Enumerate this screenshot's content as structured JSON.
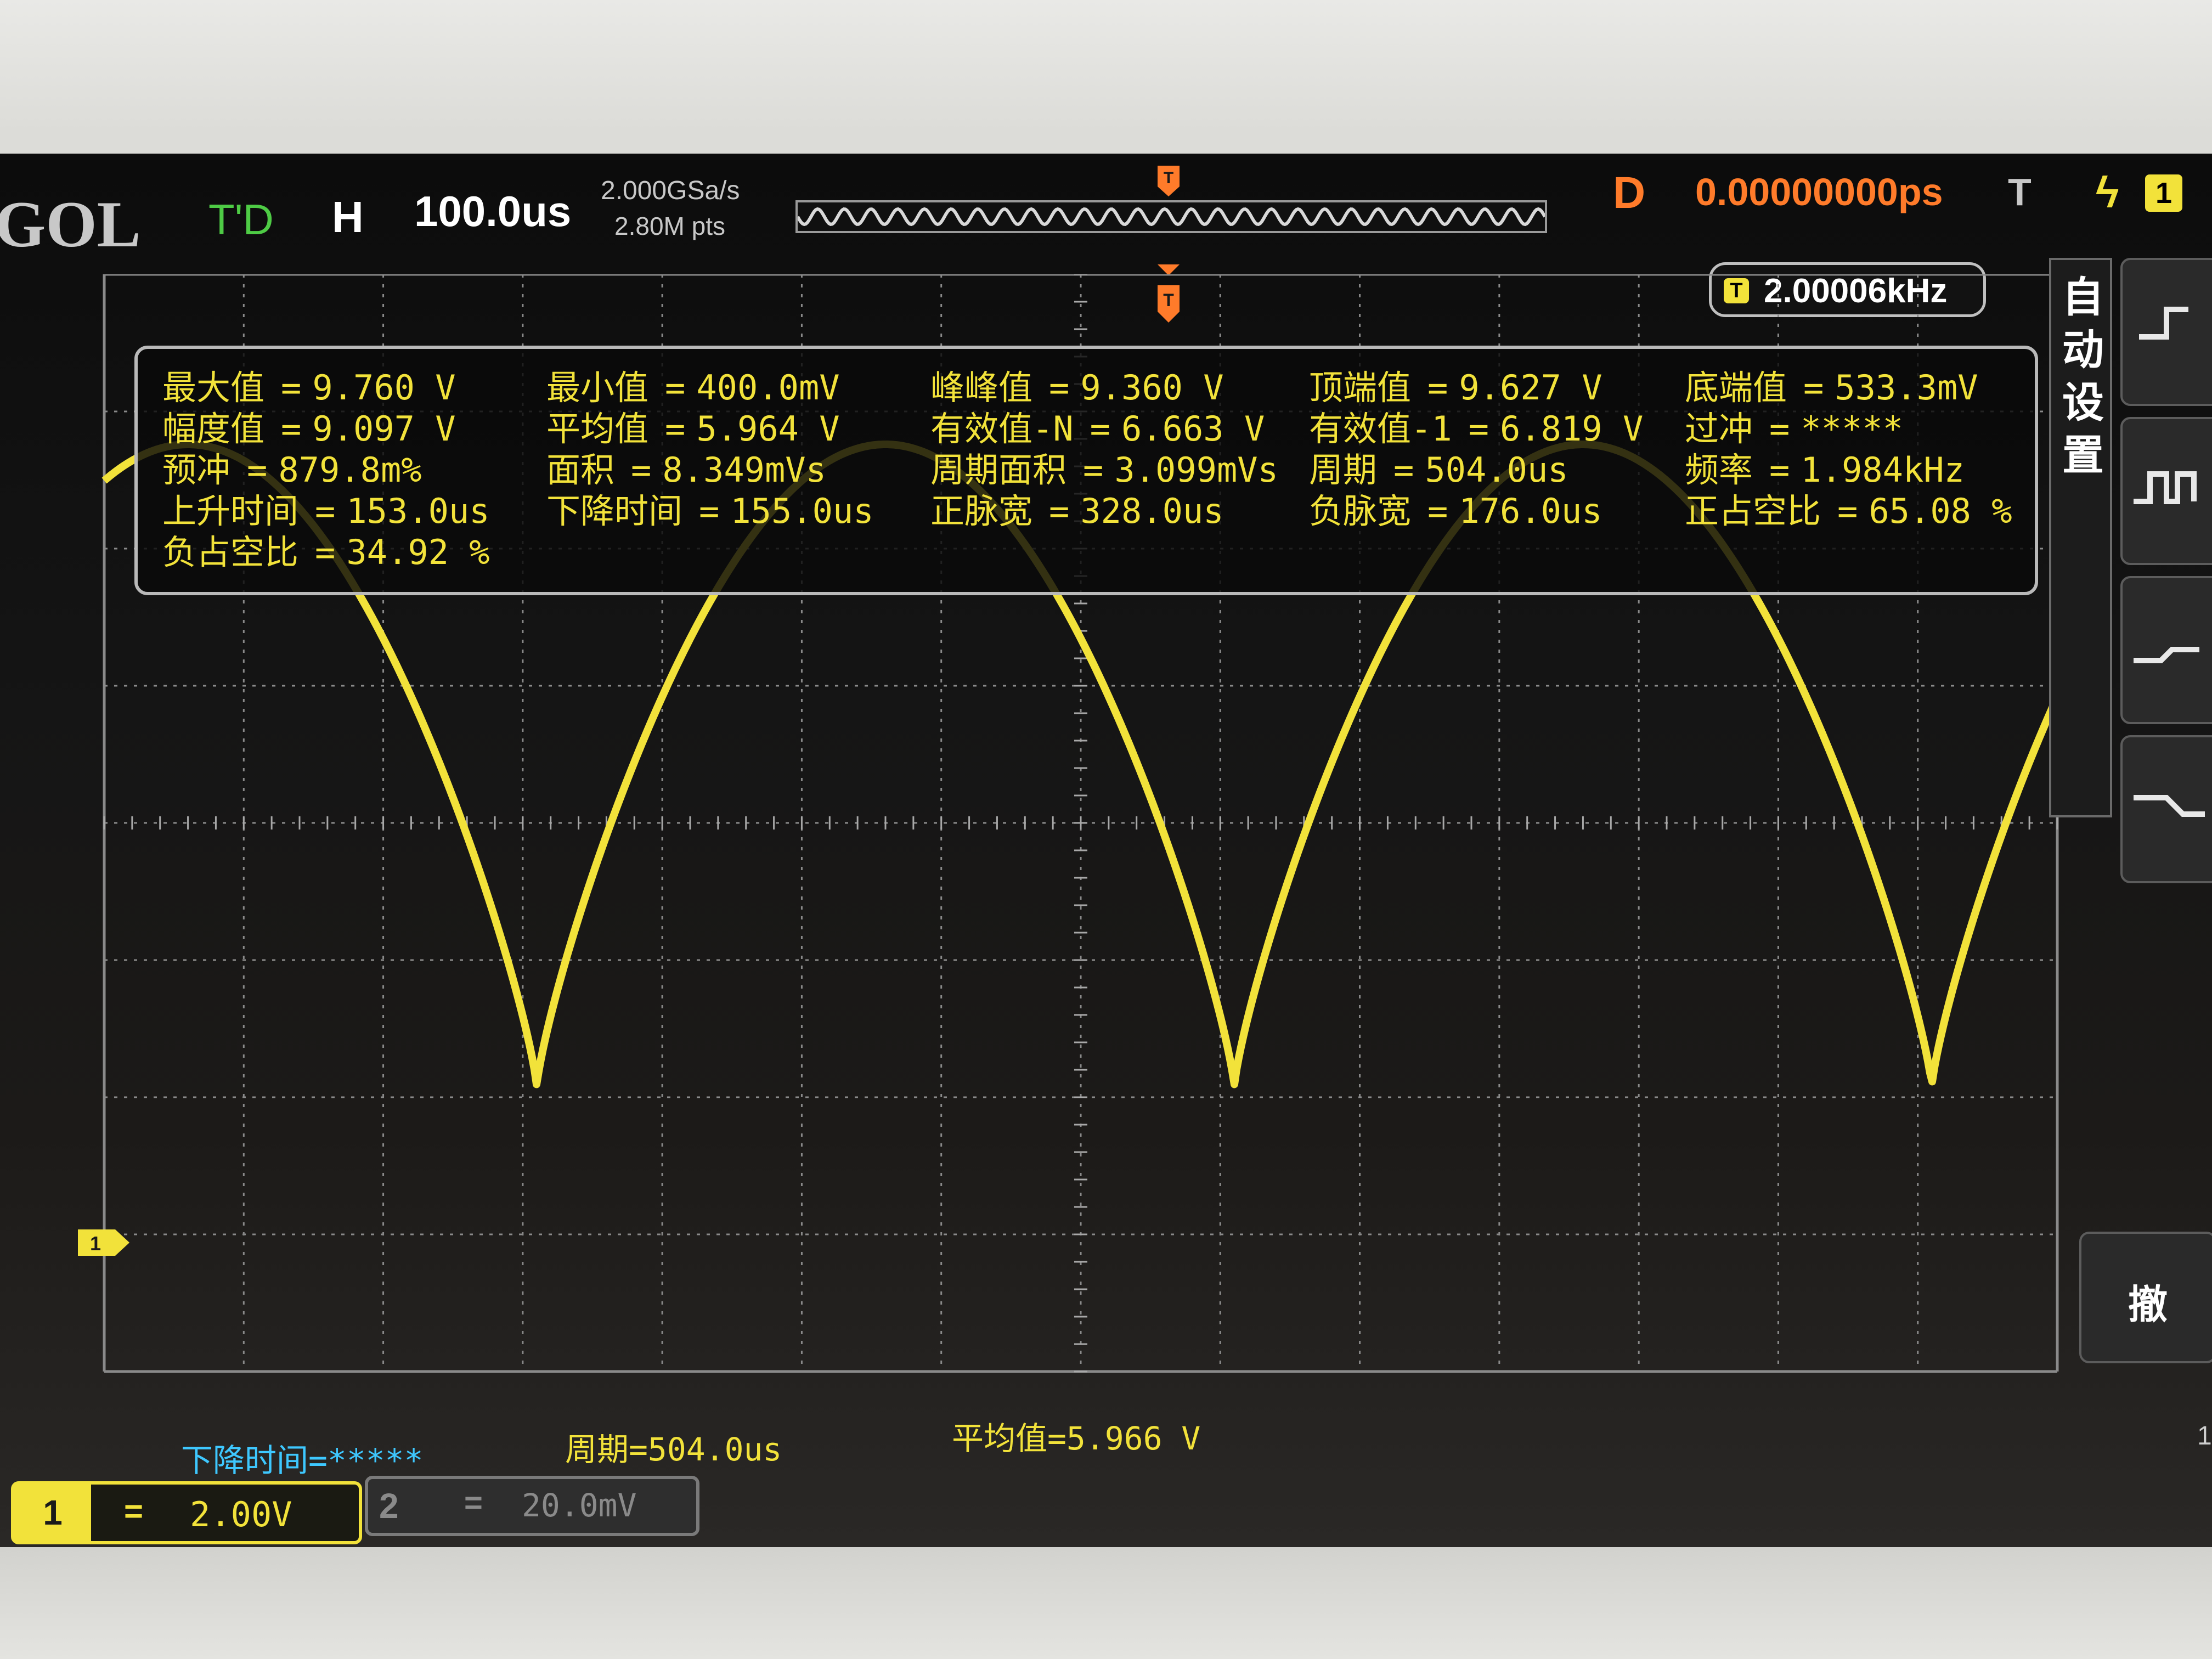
{
  "topbar": {
    "brand": "GOL",
    "run_state": "T'D",
    "horizontal_label": "H",
    "timebase": "100.0us",
    "sample_rate": "2.000GSa/s",
    "memory_depth": "2.80M pts",
    "delay_label": "D",
    "delay_value": "0.00000000ps",
    "trigger_label": "T",
    "trigger_edge_icon": "rising-edge-icon",
    "trigger_source": "1"
  },
  "frequency_counter": {
    "icon": "T",
    "value": "2.00006kHz"
  },
  "measurements": [
    {
      "name": "最大值",
      "value": "9.760 V"
    },
    {
      "name": "最小值",
      "value": "400.0mV"
    },
    {
      "name": "峰峰值",
      "value": "9.360 V"
    },
    {
      "name": "顶端值",
      "value": "9.627 V"
    },
    {
      "name": "底端值",
      "value": "533.3mV"
    },
    {
      "name": "幅度值",
      "value": "9.097 V"
    },
    {
      "name": "平均值",
      "value": "5.964 V"
    },
    {
      "name": "有效值-N",
      "value": "6.663 V"
    },
    {
      "name": "有效值-1",
      "value": "6.819 V"
    },
    {
      "name": "过冲",
      "value": "*****"
    },
    {
      "name": "预冲",
      "value": "879.8m%"
    },
    {
      "name": "面积",
      "value": "8.349mVs"
    },
    {
      "name": "周期面积",
      "value": "3.099mVs"
    },
    {
      "name": "周期",
      "value": "504.0us"
    },
    {
      "name": "频率",
      "value": "1.984kHz"
    },
    {
      "name": "上升时间",
      "value": "153.0us"
    },
    {
      "name": "下降时间",
      "value": "155.0us"
    },
    {
      "name": "正脉宽",
      "value": "328.0us"
    },
    {
      "name": "负脉宽",
      "value": "176.0us"
    },
    {
      "name": "正占空比",
      "value": "65.08 %"
    },
    {
      "name": "负占空比",
      "value": "34.92 %"
    }
  ],
  "bottom_stats": {
    "fall_time": "下降时间=*****",
    "period": "周期=504.0us",
    "mean": "平均值=5.966 V"
  },
  "channels": {
    "ch1": {
      "number": "1",
      "coupling": "=",
      "scale": "2.00V"
    },
    "ch2": {
      "number": "2",
      "coupling": "=",
      "scale": "20.0mV"
    }
  },
  "side_menu": {
    "title": "自动设置",
    "undo_label": "撤",
    "right_edge_number": "1",
    "buttons": [
      "single-cycle-icon",
      "multi-cycle-icon",
      "rising-edge-icon",
      "falling-edge-icon"
    ]
  },
  "colors": {
    "ch1": "#f2e23a",
    "stat_blue": "#3ec8ff",
    "delay_orange": "#ff7b2a",
    "run_green": "#4ecb45"
  },
  "waveform": {
    "description_units": "volts vs time",
    "frequency_khz": 2.0,
    "max_v": 9.76,
    "min_v": 0.4,
    "volts_per_div": 2.0,
    "time_per_div_us": 100.0
  }
}
